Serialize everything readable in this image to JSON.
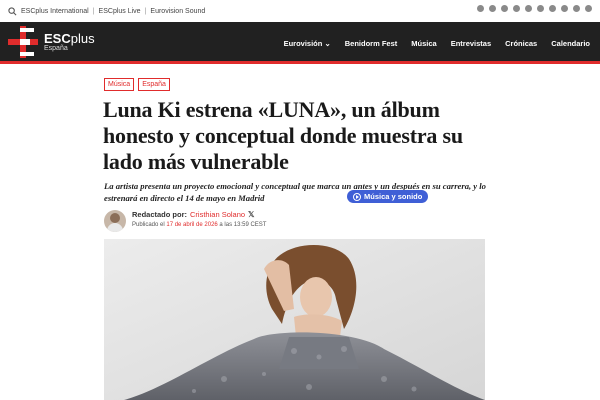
{
  "topbar": {
    "links": [
      "ESCplus International",
      "ESCplus Live",
      "Eurovision Sound"
    ]
  },
  "navbar": {
    "logo_main": "ESC",
    "logo_plus": "plus",
    "logo_sub": "España",
    "items": [
      "Eurovisión",
      "Benidorm Fest",
      "Música",
      "Entrevistas",
      "Crónicas",
      "Calendario"
    ]
  },
  "article": {
    "tags": [
      "Música",
      "España"
    ],
    "title": "Luna Ki estrena «LUNA», un álbum honesto y conceptual donde muestra su lado más vulnerable",
    "lead": "La artista presenta un proyecto emocional y conceptual que marca un antes y un después en su carrera, y lo estrenará en directo el 14 de mayo en Madrid",
    "pill_label": "Música y sonido",
    "byline_prefix": "Redactado por:",
    "author": "Cristhian Solano",
    "date_prefix": "Publicado el",
    "date": "17 de abril de 2026",
    "time": "a las 13:59 CEST"
  },
  "colors": {
    "accent": "#e02c2c",
    "navbar_bg": "#212121",
    "pill_bg": "#3f5fd6"
  }
}
